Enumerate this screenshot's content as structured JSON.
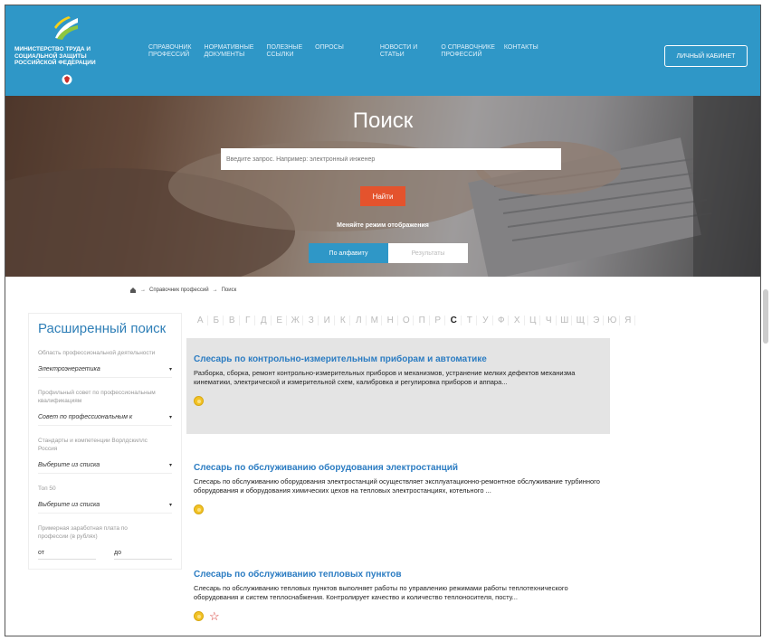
{
  "header": {
    "logo_text": "МИНИСТЕРСТВО ТРУДА И СОЦИАЛЬНОЙ ЗАЩИТЫ РОССИЙСКОЙ ФЕДЕРАЦИИ",
    "nav": [
      {
        "line1": "СПРАВОЧНИК",
        "line2": "ПРОФЕССИЙ"
      },
      {
        "line1": "НОРМАТИВНЫЕ",
        "line2": "ДОКУМЕНТЫ"
      },
      {
        "line1": "ПОЛЕЗНЫЕ",
        "line2": "ССЫЛКИ"
      },
      {
        "line1": "ОПРОСЫ",
        "line2": ""
      },
      {
        "line1": "НОВОСТИ И",
        "line2": "СТАТЬИ"
      },
      {
        "line1": "О СПРАВОЧНИКЕ",
        "line2": "ПРОФЕССИЙ"
      },
      {
        "line1": "КОНТАКТЫ",
        "line2": ""
      }
    ],
    "cabinet_label": "ЛИЧНЫЙ КАБИНЕТ",
    "brand_color": "#2f97c7"
  },
  "hero": {
    "title": "Поиск",
    "search_placeholder": "Введите запрос. Например: электронный инженер",
    "search_button": "Найти",
    "mode_label": "Меняйте режим отображения",
    "mode_alphabet": "По алфавиту",
    "mode_results": "Результаты"
  },
  "breadcrumb": {
    "home_icon": "home-icon",
    "items": [
      "Справочник профессий",
      "Поиск"
    ],
    "separator": "→"
  },
  "sidebar": {
    "title": "Расширенный поиск",
    "filters": [
      {
        "label": "Область профессиональной деятельности",
        "value": "Электроэнергетика"
      },
      {
        "label": "Профильный совет по профессиональным квалификациям",
        "value": "Совет по профессиональным к"
      },
      {
        "label": "Стандарты и компетенции Ворлдскиллс Россия",
        "value": "Выберите из списка"
      },
      {
        "label": "Топ 50",
        "value": "Выберите из списка"
      }
    ],
    "salary_label": "Примерная заработная плата по профессии (в рублях)",
    "from_label": "от",
    "to_label": "до"
  },
  "alphabet": {
    "letters": [
      "А",
      "Б",
      "В",
      "Г",
      "Д",
      "Е",
      "Ж",
      "З",
      "И",
      "К",
      "Л",
      "М",
      "Н",
      "О",
      "П",
      "Р",
      "С",
      "Т",
      "У",
      "Ф",
      "Х",
      "Ц",
      "Ч",
      "Ш",
      "Щ",
      "Э",
      "Ю",
      "Я"
    ],
    "active": "С"
  },
  "results": [
    {
      "title": "Слесарь по контрольно-измерительным приборам и автоматике",
      "description": "Разборка, сборка, ремонт контрольно-измерительных приборов и механизмов, устранение мелких дефектов механизма кинематики, электрической и измерительной схем, калибровка и регулировка приборов и аппара...",
      "highlighted": true,
      "favorite": false
    },
    {
      "title": "Слесарь по обслуживанию оборудования электростанций",
      "description": "Слесарь по обслуживанию оборудования электростанций осуществляет эксплуатационно-ремонтное обслуживание турбинного оборудования и оборудования химических цехов на тепловых электростанциях, котельного ...",
      "highlighted": false,
      "favorite": false
    },
    {
      "title": "Слесарь по обслуживанию тепловых пунктов",
      "description": "Слесарь по обслуживанию тепловых пунктов выполняет работы по управлению режимами работы теплотехнического оборудования и систем теплоснабжения. Контролирует качество и количество теплоносителя, посту...",
      "highlighted": false,
      "favorite": true
    }
  ]
}
